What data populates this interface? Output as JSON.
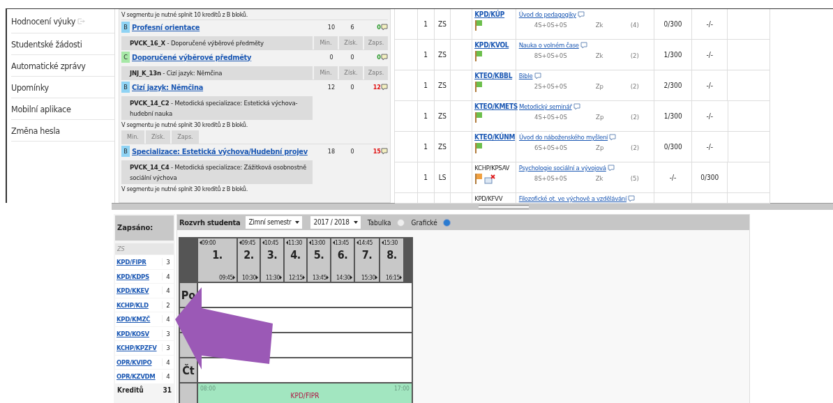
{
  "sidebar": {
    "items": [
      {
        "label": "Hodnocení výuky",
        "kind": "external"
      },
      {
        "label": "Studentské žádosti",
        "kind": "plain"
      },
      {
        "label": "Automatické zprávy",
        "kind": "plain"
      },
      {
        "label": "Upomínky",
        "kind": "plain"
      },
      {
        "label": "Mobilní aplikace",
        "kind": "plain"
      },
      {
        "label": "Změna hesla",
        "kind": "plain"
      }
    ]
  },
  "blocks": [
    {
      "kind": "note",
      "text": "V segmentu je nutné splnit 10 kreditů z B bloků."
    },
    {
      "kind": "row",
      "badge": "B",
      "color": "#8fd3f4",
      "title": "Profesní orientace",
      "min": "10",
      "earned": "6",
      "enrolled": "0",
      "enrolled_ok": true
    },
    {
      "kind": "header",
      "title": "**PVCK_16_X** - Doporučené výběrové předměty",
      "columns": [
        "Min.",
        "Získ.",
        "Zaps."
      ]
    },
    {
      "kind": "row",
      "badge": "C",
      "color": "#a6e8a6",
      "title": "Doporučené výběrové předměty",
      "min": "0",
      "earned": "0",
      "enrolled": "0",
      "enrolled_ok": true
    },
    {
      "kind": "header",
      "title": "**JNJ_K_13n** - Cizí jazyk: Němčina",
      "columns": [
        "Min.",
        "Získ.",
        "Zaps."
      ]
    },
    {
      "kind": "row",
      "badge": "B",
      "color": "#8fd3f4",
      "title": "Cizí jazyk: Němčina",
      "min": "12",
      "earned": "0",
      "enrolled": "12",
      "enrolled_ok": false
    },
    {
      "kind": "header",
      "title": "**PVCK_14_C2** - Metodická specializace: Estetická výchova-hudební nauka"
    },
    {
      "kind": "note",
      "text": "V segmentu je nutné splnit 30 kreditů z B bloků."
    },
    {
      "kind": "column_labels",
      "columns": [
        "Min.",
        "Získ.",
        "Zaps."
      ]
    },
    {
      "kind": "row",
      "badge": "B",
      "color": "#8fd3f4",
      "title": "Specializace: Estetická výchova/Hudební projev",
      "min": "18",
      "earned": "0",
      "enrolled": "15",
      "enrolled_ok": false
    },
    {
      "kind": "header",
      "title": "**PVCK_14_C4** - Metodická specializace: Zážitková osobnostně sociální výchova"
    },
    {
      "kind": "note",
      "text": "V segmentu je nutné splnit 30 kreditů z B bloků."
    }
  ],
  "courses": [
    {
      "year": "1",
      "semester": "ZS",
      "code": "KPD/KÚP",
      "linked": true,
      "icons": [
        {
          "kind": "flag",
          "color": "#6cbf4c"
        }
      ],
      "name": "Úvod do pedagogiky",
      "hours": "4S+0S+0S",
      "completion": "Zk",
      "credits": "(4)",
      "capacity_1": "0/300",
      "capacity_2": "-/-"
    },
    {
      "year": "1",
      "semester": "ZS",
      "code": "KPD/KVOL",
      "linked": true,
      "icons": [
        {
          "kind": "flag",
          "color": "#6cbf4c"
        }
      ],
      "name": "Nauka o volném čase",
      "hours": "8S+0S+0S",
      "completion": "Zk",
      "credits": "(2)",
      "capacity_1": "1/300",
      "capacity_2": "-/-"
    },
    {
      "year": "1",
      "semester": "ZS",
      "code": "KTEO/KBBL",
      "linked": true,
      "icons": [
        {
          "kind": "flag",
          "color": "#6cbf4c"
        }
      ],
      "name": "Bible",
      "hours": "2S+0S+0S",
      "completion": "Zp",
      "credits": "(2)",
      "capacity_1": "2/300",
      "capacity_2": "-/-"
    },
    {
      "year": "1",
      "semester": "ZS",
      "code": "KTEO/KMETS",
      "linked": true,
      "icons": [
        {
          "kind": "flag",
          "color": "#6cbf4c"
        }
      ],
      "name": "Metodický seminář",
      "hours": "4S+0S+0S",
      "completion": "Zp",
      "credits": "(2)",
      "capacity_1": "1/300",
      "capacity_2": "-/-"
    },
    {
      "year": "1",
      "semester": "ZS",
      "code": "KTEO/KÚNM",
      "linked": true,
      "icons": [
        {
          "kind": "flag",
          "color": "#6cbf4c"
        }
      ],
      "name": "Úvod do náboženského myšlení",
      "hours": "6S+0S+0S",
      "completion": "Zp",
      "credits": "(2)",
      "capacity_1": "0/300",
      "capacity_2": "-/-"
    },
    {
      "year": "1",
      "semester": "LS",
      "code": "KCHP/KPSAV",
      "linked": false,
      "icons": [
        {
          "kind": "flag",
          "color": "#f0a040"
        },
        {
          "kind": "calendar_cross"
        }
      ],
      "name": "Psychologie sociální a vývojová",
      "hours": "8S+0S+0S",
      "completion": "Zk",
      "credits": "(5)",
      "capacity_1": "-/-",
      "capacity_2": "0/300"
    },
    {
      "code": "KPD/KFVV",
      "linked": false,
      "name": "Filozofické ot. ve výchově a vzdělávání"
    }
  ],
  "enrolled": {
    "title": "Zapsáno:",
    "semester": "ZS",
    "items": [
      {
        "code": "KPD/FIPR",
        "credits": "3"
      },
      {
        "code": "KPD/KDPS",
        "credits": "4"
      },
      {
        "code": "KPD/KKEV",
        "credits": "4"
      },
      {
        "code": "KCHP/KLD",
        "credits": "2"
      },
      {
        "code": "KPD/KMZČ",
        "credits": "4"
      },
      {
        "code": "KPD/KOSV",
        "credits": "3"
      },
      {
        "code": "KCHP/KPZFV",
        "credits": "3"
      },
      {
        "code": "OPR/KVIPO",
        "credits": "4"
      },
      {
        "code": "OPR/KZVDM",
        "credits": "4"
      }
    ],
    "total_label": "Kreditů",
    "total": "31"
  },
  "schedule": {
    "title": "Rozvrh studenta",
    "semester": "Zimní semestr",
    "year": "2017 / 2018",
    "views": [
      {
        "label": "Tabulka",
        "selected": false
      },
      {
        "label": "Grafické",
        "selected": true
      }
    ],
    "periods": [
      {
        "number": "1.",
        "start": "09:00",
        "end": "09:45"
      },
      {
        "number": "2.",
        "start": "09:45",
        "end": "10:30"
      },
      {
        "number": "3.",
        "start": "10:45",
        "end": "11:30"
      },
      {
        "number": "4.",
        "start": "11:30",
        "end": "12:15"
      },
      {
        "number": "5.",
        "start": "13:00",
        "end": "13:45"
      },
      {
        "number": "6.",
        "start": "13:45",
        "end": "14:30"
      },
      {
        "number": "7.",
        "start": "14:45",
        "end": "15:30"
      },
      {
        "number": "8.",
        "start": "15:30",
        "end": "16:15"
      }
    ],
    "days": [
      {
        "kind": "labeled",
        "label": "Po"
      },
      {
        "kind": "covered"
      },
      {
        "kind": "covered"
      },
      {
        "kind": "labeled",
        "label": "Čt"
      }
    ],
    "event": {
      "start": "08:00",
      "end": "17:00",
      "code": "KPD/FIPR"
    }
  }
}
